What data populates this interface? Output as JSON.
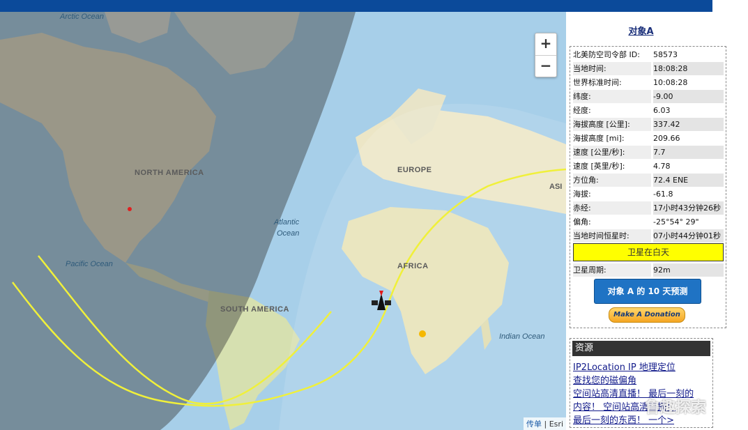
{
  "map": {
    "labels": {
      "arctic": "Arctic Ocean",
      "north_america": "NORTH AMERICA",
      "europe": "EUROPE",
      "asia": "ASI",
      "atlantic1": "Atlantic",
      "atlantic2": "Ocean",
      "pacific": "Pacific Ocean",
      "africa": "AFRICA",
      "south_america": "SOUTH AMERICA",
      "indian": "Indian Ocean"
    },
    "zoom_in": "+",
    "zoom_out": "−",
    "attribution_link": "传单",
    "attribution_sep": " | ",
    "attribution_provider": "Esri"
  },
  "panel": {
    "title": "对象A",
    "rows": [
      {
        "label": "北美防空司令部 ID:",
        "value": "58573"
      },
      {
        "label": "当地时间:",
        "value": "18:08:28"
      },
      {
        "label": "世界标准时间:",
        "value": "10:08:28"
      },
      {
        "label": "纬度:",
        "value": "-9.00"
      },
      {
        "label": "经度:",
        "value": "6.03"
      },
      {
        "label": "海拔高度 [公里]:",
        "value": "337.42"
      },
      {
        "label": "海拔高度 [mi]:",
        "value": "209.66"
      },
      {
        "label": "速度 [公里/秒]:",
        "value": "7.7"
      },
      {
        "label": "速度 [英里/秒]:",
        "value": "4.78"
      },
      {
        "label": "方位角:",
        "value": "72.4 ENE"
      },
      {
        "label": "海拔:",
        "value": "-61.8"
      },
      {
        "label": "赤经:",
        "value": "17小时43分钟26秒"
      },
      {
        "label": "偏角:",
        "value": "-25°54° 29\""
      },
      {
        "label": "当地时间恒星时:",
        "value": "07小时44分钟01秒"
      }
    ],
    "daylight": "卫星在白天",
    "period_label": "卫星周期:",
    "period_value": "92m",
    "predict_button": "对象 A 的 10 天预测",
    "donate_button": "Make A Donation"
  },
  "resources": {
    "title": "资源",
    "links": [
      "IP2Location IP 地理定位",
      "查找您的磁偏角",
      "空间站高清直播！ 最后一刻的",
      "内容！ 空间站高清直播！",
      "最后一刻的东西！ 一个>"
    ]
  },
  "watermark": "鲁趣探索"
}
